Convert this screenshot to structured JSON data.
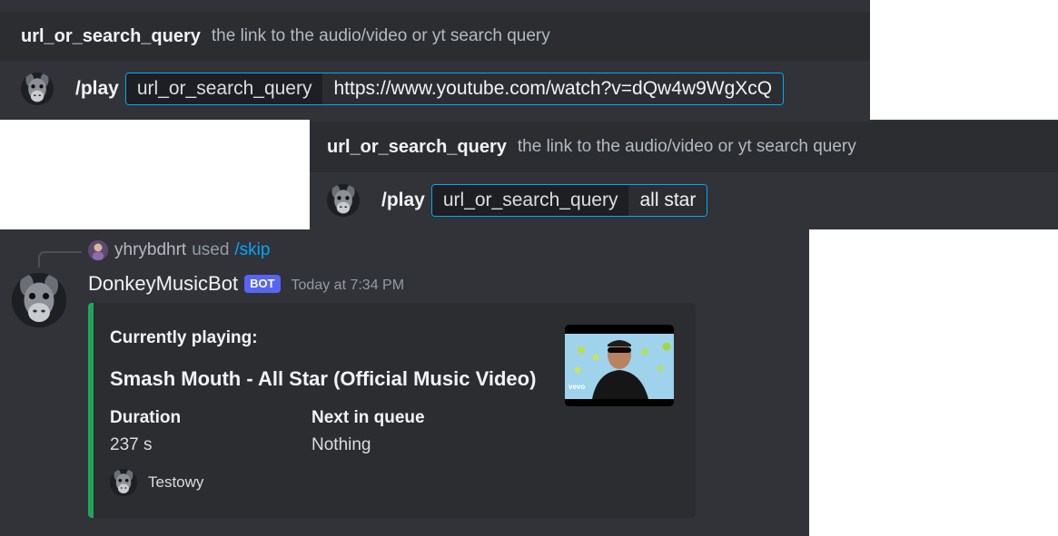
{
  "option_hint_top": {
    "name": "url_or_search_query",
    "description": "the link to the audio/video or yt search query"
  },
  "command_top": {
    "command": "/play",
    "option_key": "url_or_search_query",
    "option_value": "https://www.youtube.com/watch?v=dQw4w9WgXcQ"
  },
  "option_hint_bottom": {
    "name": "url_or_search_query",
    "description": "the link to the audio/video or yt search query"
  },
  "command_bottom": {
    "command": "/play",
    "option_key": "url_or_search_query",
    "option_value": "all star"
  },
  "reply": {
    "username": "yhrybdhrt",
    "used_text": "used",
    "command": "/skip"
  },
  "message": {
    "author": "DonkeyMusicBot",
    "tag": "BOT",
    "timestamp": "Today at 7:34 PM"
  },
  "embed": {
    "accent_color": "#23a559",
    "label": "Currently playing:",
    "title": "Smash Mouth - All Star (Official Music Video)",
    "fields": [
      {
        "name": "Duration",
        "value": "237 s"
      },
      {
        "name": "Next in queue",
        "value": "Nothing"
      }
    ],
    "thumbnail_watermark": "vevo",
    "footer_text": "Testowy"
  },
  "colors": {
    "link": "#00a8fc",
    "bot_tag": "#5865f2"
  }
}
